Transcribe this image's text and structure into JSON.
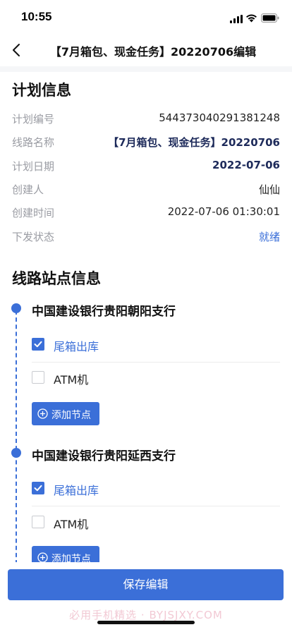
{
  "status_bar": {
    "time": "10:55"
  },
  "nav": {
    "title": "【7月箱包、现金任务】20220706编辑"
  },
  "plan_info": {
    "section_title": "计划信息",
    "rows": [
      {
        "label": "计划编号",
        "value": "544373040291381248"
      },
      {
        "label": "线路名称",
        "value": "【7月箱包、现金任务】20220706"
      },
      {
        "label": "计划日期",
        "value": "2022-07-06"
      },
      {
        "label": "创建人",
        "value": "仙仙"
      },
      {
        "label": "创建时间",
        "value": "2022-07-06 01:30:01"
      },
      {
        "label": "下发状态",
        "value": "就绪"
      }
    ]
  },
  "route": {
    "section_title": "线路站点信息",
    "stops": [
      {
        "name": "中国建设银行贵阳朝阳支行",
        "tasks": [
          {
            "label": "尾箱出库",
            "checked": true
          },
          {
            "label": "ATM机",
            "checked": false
          }
        ],
        "add_button_label": "添加节点"
      },
      {
        "name": "中国建设银行贵阳延西支行",
        "tasks": [
          {
            "label": "尾箱出库",
            "checked": true
          },
          {
            "label": "ATM机",
            "checked": false
          }
        ],
        "add_button_label": "添加节点"
      }
    ]
  },
  "footer": {
    "save_label": "保存编辑",
    "watermark": "必用手机精选 · BYJSJXY.COM"
  },
  "colors": {
    "accent": "#3b6fd8",
    "label_gray": "#9a9ca3",
    "strong_value": "#1d2a5a"
  }
}
